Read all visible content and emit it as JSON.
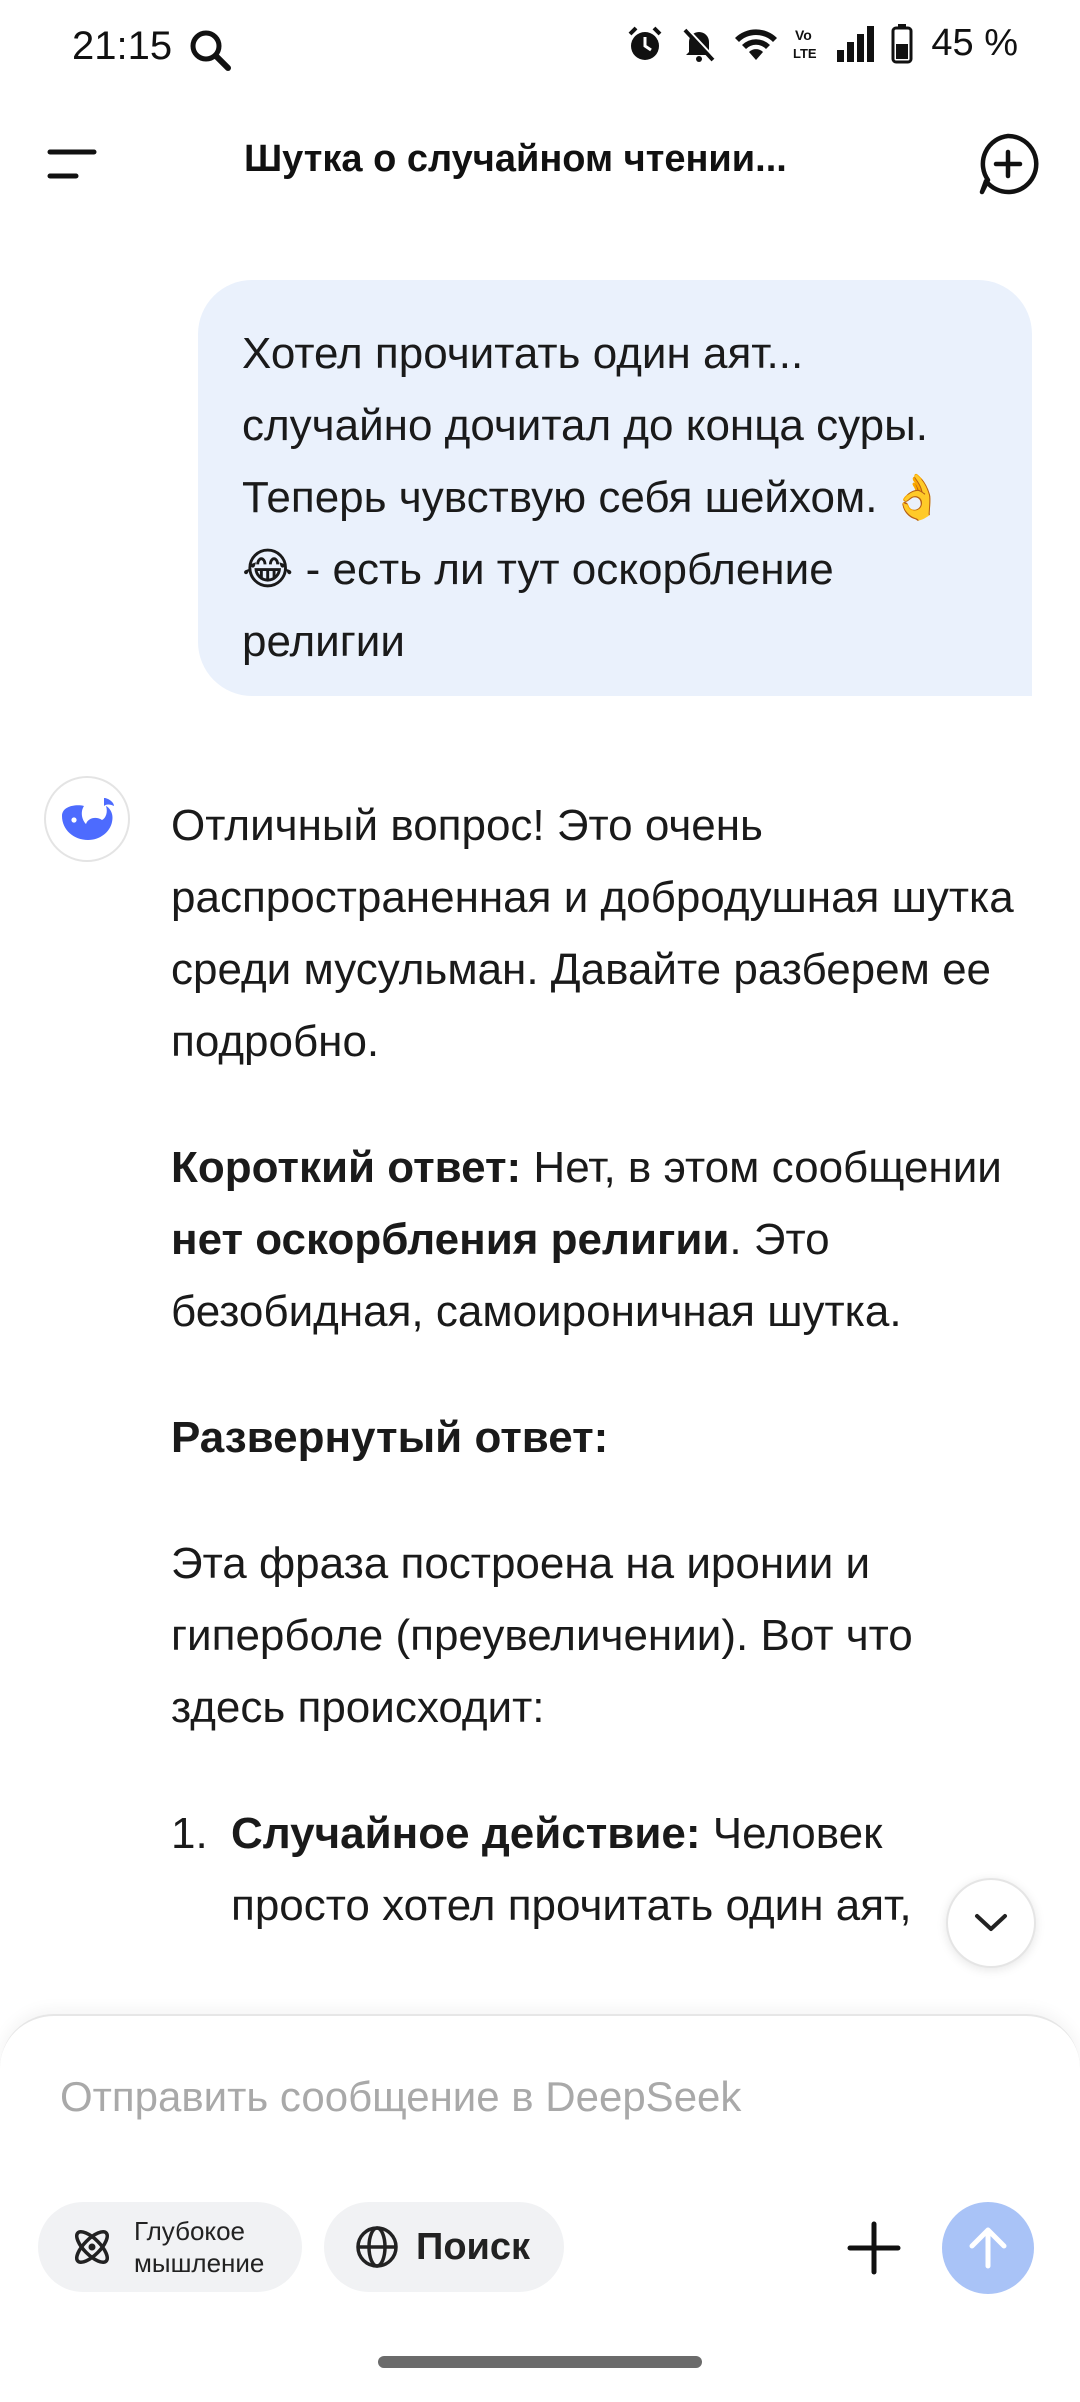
{
  "status_bar": {
    "time": "21:15",
    "battery_text": "45 %",
    "icons": [
      "search-icon",
      "alarm-icon",
      "mute-icon",
      "wifi-icon",
      "volte-icon",
      "signal-icon",
      "battery-icon"
    ]
  },
  "header": {
    "title": "Шутка о случайном чтении..."
  },
  "user_message": {
    "text": "Хотел прочитать один аят...\nслучайно дочитал до конца суры.\nТеперь чувствую себя шейхом. 👌\n😂 - есть ли тут оскорбление\nрелигии"
  },
  "assistant_message": {
    "intro": "Отличный вопрос! Это очень распространенная и добродушная шутка среди мусульман. Давайте разберем ее подробно.",
    "short_label": "Короткий ответ:",
    "short_text_1": " Нет, в этом сообщении ",
    "short_bold": "нет оскорбления религии",
    "short_text_2": ". Это безобидная, самоироничная шутка.",
    "expanded_label": "Развернутый ответ:",
    "explanation": "Эта фраза построена на иронии и гиперболе (преувеличении). Вот что здесь происходит:",
    "list": [
      {
        "num": "1.",
        "bold": "Случайное действие:",
        "text": " Человек просто хотел прочитать один аят,"
      }
    ]
  },
  "composer": {
    "placeholder": "Отправить сообщение в DeepSeek",
    "deep_thinking_label": "Глубокое\nмышление",
    "search_label": "Поиск"
  },
  "colors": {
    "user_bubble": "#eaf1fc",
    "accent": "#4d6bfe",
    "send_button_disabled": "#a9c3f7"
  }
}
